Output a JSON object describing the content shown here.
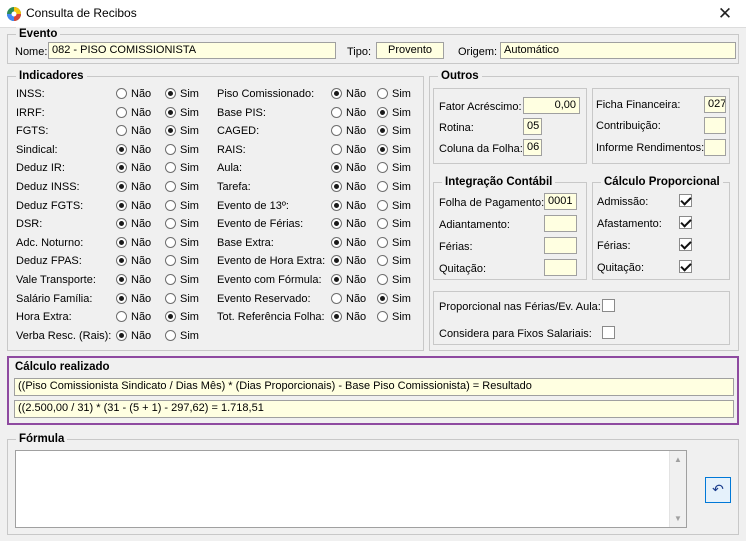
{
  "window": {
    "title": "Consulta de Recibos",
    "close_glyph": "✕"
  },
  "evento": {
    "legend": "Evento",
    "nome_label": "Nome:",
    "nome_value": "082 - PISO COMISSIONISTA",
    "tipo_label": "Tipo:",
    "tipo_value": "Provento",
    "origem_label": "Origem:",
    "origem_value": "Automático"
  },
  "indicadores": {
    "legend": "Indicadores",
    "nao": "Não",
    "sim": "Sim",
    "left": [
      {
        "label": "INSS:",
        "value": "Sim"
      },
      {
        "label": "IRRF:",
        "value": "Sim"
      },
      {
        "label": "FGTS:",
        "value": "Sim"
      },
      {
        "label": "Sindical:",
        "value": "Não"
      },
      {
        "label": "Deduz IR:",
        "value": "Não"
      },
      {
        "label": "Deduz INSS:",
        "value": "Não"
      },
      {
        "label": "Deduz FGTS:",
        "value": "Não"
      },
      {
        "label": "DSR:",
        "value": "Não"
      },
      {
        "label": "Adc. Noturno:",
        "value": "Não"
      },
      {
        "label": "Deduz FPAS:",
        "value": "Não"
      },
      {
        "label": "Vale Transporte:",
        "value": "Não"
      },
      {
        "label": "Salário Família:",
        "value": "Não"
      },
      {
        "label": "Hora Extra:",
        "value": "Sim"
      },
      {
        "label": "Verba Resc. (Rais):",
        "value": "Não"
      }
    ],
    "right": [
      {
        "label": "Piso Comissionado:",
        "value": "Não"
      },
      {
        "label": "Base PIS:",
        "value": "Sim"
      },
      {
        "label": "CAGED:",
        "value": "Sim"
      },
      {
        "label": "RAIS:",
        "value": "Sim"
      },
      {
        "label": "Aula:",
        "value": "Não"
      },
      {
        "label": "Tarefa:",
        "value": "Não"
      },
      {
        "label": "Evento de 13º:",
        "value": "Não"
      },
      {
        "label": "Evento de Férias:",
        "value": "Não"
      },
      {
        "label": "Base Extra:",
        "value": "Não"
      },
      {
        "label": "Evento de Hora Extra:",
        "value": "Não"
      },
      {
        "label": "Evento com Fórmula:",
        "value": "Não"
      },
      {
        "label": "Evento Reservado:",
        "value": "Sim"
      },
      {
        "label": "Tot. Referência Folha:",
        "value": "Não"
      }
    ]
  },
  "outros": {
    "legend": "Outros",
    "fator_label": "Fator Acréscimo:",
    "fator_value": "0,00",
    "rotina_label": "Rotina:",
    "rotina_value": "05",
    "coluna_label": "Coluna da Folha:",
    "coluna_value": "06",
    "ficha_label": "Ficha Financeira:",
    "ficha_value": "027",
    "contribuicao_label": "Contribuição:",
    "contribuicao_value": "",
    "informe_label": "Informe Rendimentos:",
    "informe_value": ""
  },
  "integracao": {
    "legend": "Integração Contábil",
    "items": [
      {
        "label": "Folha de Pagamento:",
        "value": "0001"
      },
      {
        "label": "Adiantamento:",
        "value": ""
      },
      {
        "label": "Férias:",
        "value": ""
      },
      {
        "label": "Quitação:",
        "value": ""
      }
    ]
  },
  "proporcional": {
    "legend": "Cálculo Proporcional",
    "items": [
      {
        "label": "Admissão:",
        "checked": true
      },
      {
        "label": "Afastamento:",
        "checked": true
      },
      {
        "label": "Férias:",
        "checked": true
      },
      {
        "label": "Quitação:",
        "checked": true
      }
    ]
  },
  "extras": {
    "proporcional_ferias_label": "Proporcional nas Férias/Ev. Aula:",
    "fixos_label": "Considera para Fixos Salariais:"
  },
  "calculo": {
    "legend": "Cálculo realizado",
    "formula_text": "((Piso Comissionista Sindicato / Dias Mês) * (Dias Proporcionais) - Base Piso Comissionista) = Resultado",
    "result_text": "((2.500,00 / 31) * (31 - (5 + 1) - 297,62) = 1.718,51"
  },
  "formula": {
    "legend": "Fórmula",
    "content": "",
    "undo_glyph": "↶"
  },
  "colors": {
    "accent_border": "#8e4aa0",
    "field_bg": "#ffffe1"
  }
}
